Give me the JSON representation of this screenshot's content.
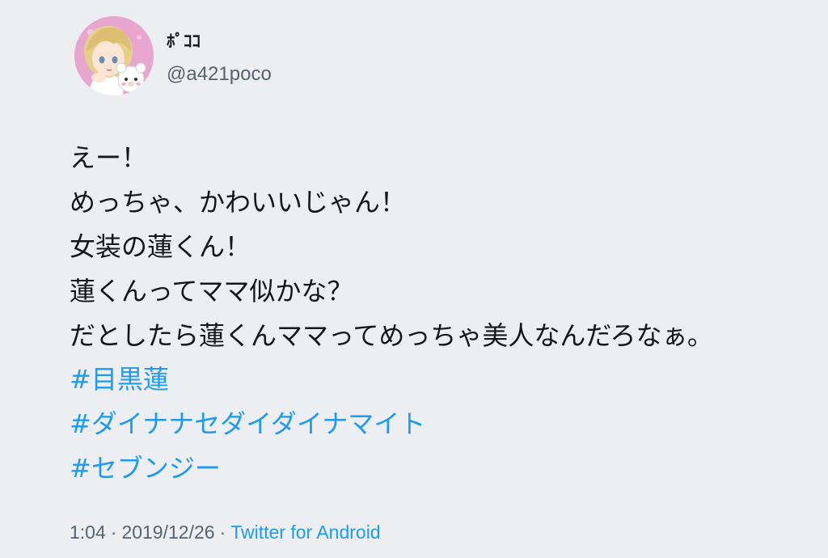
{
  "user": {
    "display_name": "ﾎﾟｺｺ",
    "handle": "@a421poco"
  },
  "tweet": {
    "lines": [
      "えー！",
      "めっちゃ、かわいいじゃん！",
      "女装の蓮くん！",
      "蓮くんってママ似かな？",
      "だとしたら蓮くんママってめっちゃ美人なんだろなぁ。"
    ],
    "hashtags": [
      "#目黒蓮",
      "#ダイナナセダイダイナマイト",
      "#セブンジー"
    ]
  },
  "meta": {
    "time": "1:04",
    "separator": "·",
    "date": "2019/12/26",
    "source": "Twitter for Android"
  },
  "colors": {
    "background": "#edeef1",
    "text": "#14171a",
    "secondary": "#536471",
    "link": "#1d9bf0"
  }
}
